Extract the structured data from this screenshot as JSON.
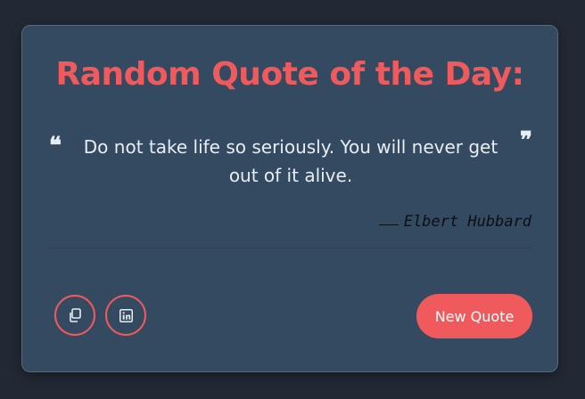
{
  "card": {
    "title": "Random Quote of the Day:",
    "quote": {
      "open_mark": "❝",
      "text": "Do not take life so seriously. You will never get out of it alive.",
      "close_mark": "❞",
      "author": "Elbert Hubbard"
    },
    "actions": {
      "copy_icon": "copy-icon",
      "linkedin_icon": "linkedin-icon",
      "new_quote_label": "New Quote"
    }
  },
  "colors": {
    "page_background": "#222934",
    "card_background": "#344a60",
    "accent": "#f15a5c",
    "text_light": "#e8edf2",
    "author_text": "#0b0f14"
  }
}
